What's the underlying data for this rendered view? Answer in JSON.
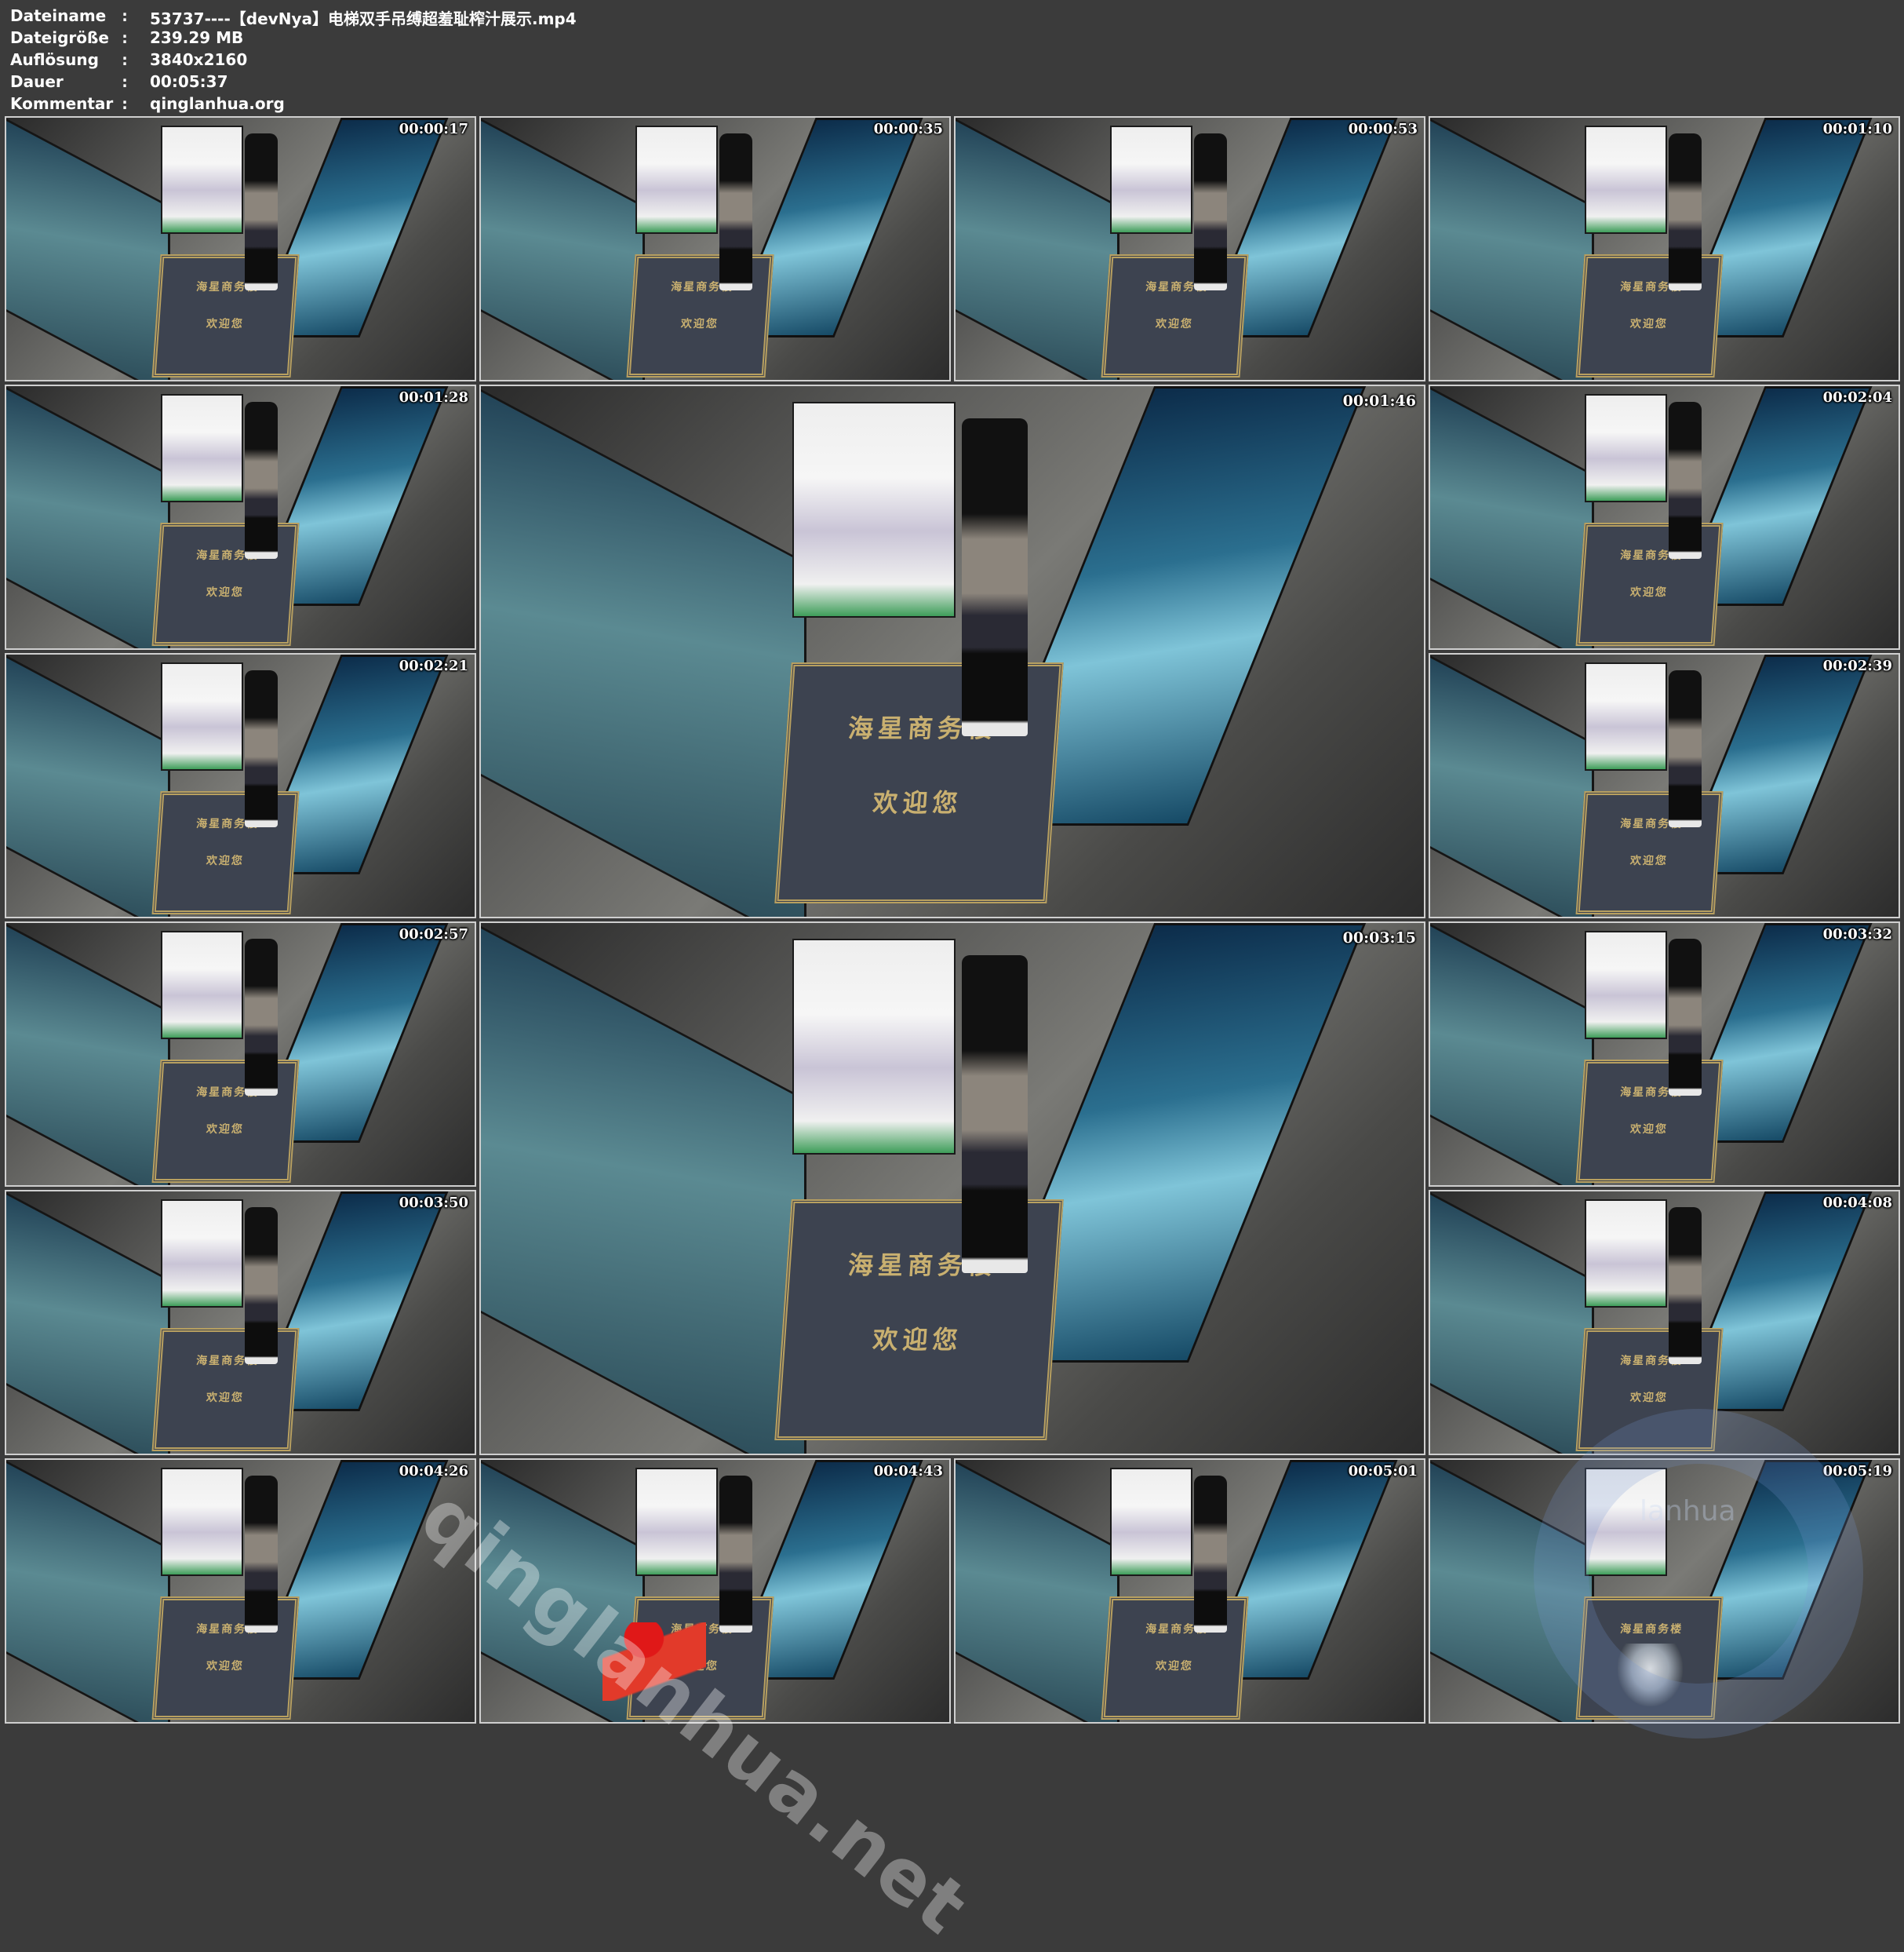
{
  "header": {
    "rows": [
      {
        "label": "Dateiname",
        "value": "53737----【devNya】电梯双手吊缚超羞耻榨汁展示.mp4"
      },
      {
        "label": "Dateigröße",
        "value": "239.29 MB"
      },
      {
        "label": "Auflösung",
        "value": "3840x2160"
      },
      {
        "label": "Dauer",
        "value": "00:05:37"
      },
      {
        "label": "Kommentar",
        "value": "qinglanhua.org"
      }
    ],
    "separator": ":"
  },
  "mat_text": {
    "line1": "海星商务楼",
    "line2": "欢迎您"
  },
  "thumbnails": [
    {
      "timestamp": "00:00:17"
    },
    {
      "timestamp": "00:00:35"
    },
    {
      "timestamp": "00:00:53"
    },
    {
      "timestamp": "00:01:10"
    },
    {
      "timestamp": "00:01:28"
    },
    {
      "timestamp": "00:01:46"
    },
    {
      "timestamp": "00:02:04"
    },
    {
      "timestamp": "00:02:21"
    },
    {
      "timestamp": "00:02:39"
    },
    {
      "timestamp": "00:02:57"
    },
    {
      "timestamp": "00:03:15"
    },
    {
      "timestamp": "00:03:32"
    },
    {
      "timestamp": "00:03:50"
    },
    {
      "timestamp": "00:04:08"
    },
    {
      "timestamp": "00:04:26"
    },
    {
      "timestamp": "00:04:43"
    },
    {
      "timestamp": "00:05:01"
    },
    {
      "timestamp": "00:05:19"
    }
  ],
  "watermark": {
    "text": "qinglanhua.net",
    "small": "lanhua"
  }
}
